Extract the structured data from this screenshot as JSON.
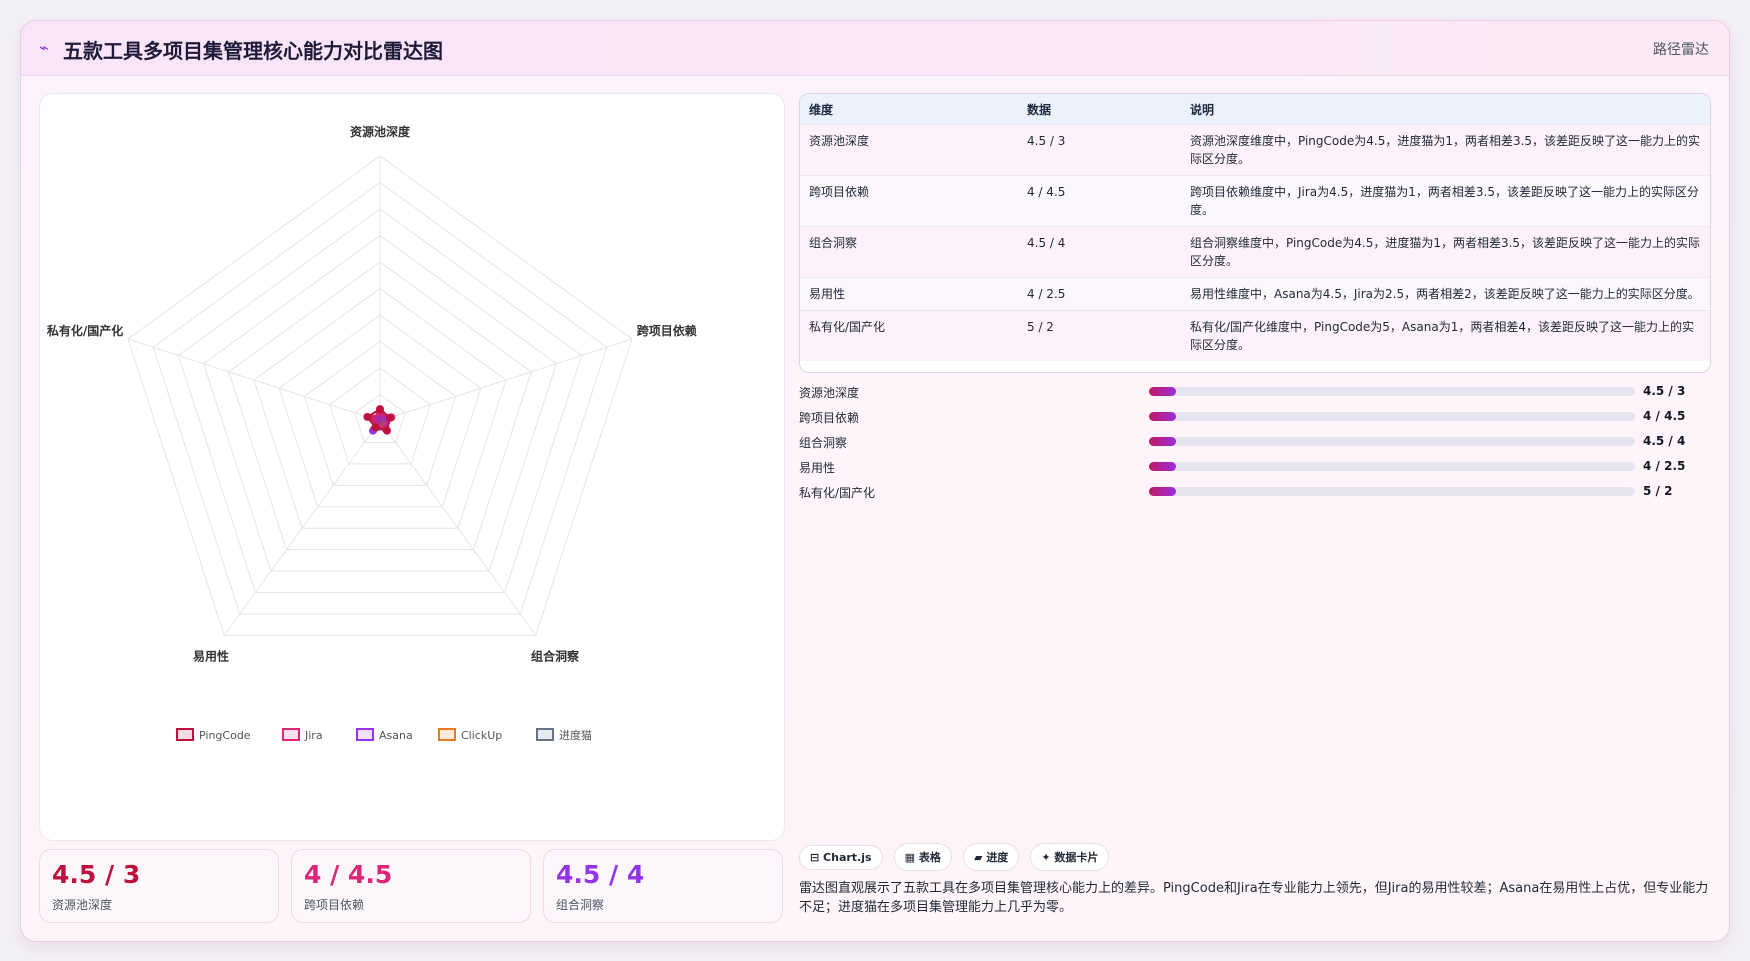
{
  "header": {
    "icon": "wave-icon",
    "title": "五款工具多项目集管理核心能力对比雷达图",
    "tag": "路径雷达"
  },
  "chart_data": {
    "type": "radar",
    "categories": [
      "资源池深度",
      "跨项目依赖",
      "组合洞察",
      "易用性",
      "私有化/国产化"
    ],
    "r_max": 100,
    "grid_levels": 10,
    "legend_position": "bottom",
    "series": [
      {
        "name": "PingCode",
        "values": [
          4.5,
          4,
          4.5,
          3,
          5
        ],
        "color": "#be123c"
      },
      {
        "name": "Jira",
        "values": [
          3.5,
          4.5,
          4,
          2.5,
          3
        ],
        "color": "#db2777"
      },
      {
        "name": "Asana",
        "values": [
          2.5,
          3,
          3.5,
          4.5,
          1
        ],
        "color": "#9333ea"
      },
      {
        "name": "ClickUp",
        "values": [
          3,
          3,
          3,
          4,
          1.5
        ],
        "color": "#ea7a1e"
      },
      {
        "name": "进度猫",
        "values": [
          1,
          1,
          1,
          4,
          2
        ],
        "color": "#64748b"
      }
    ]
  },
  "table": {
    "headers": [
      "维度",
      "数据",
      "说明"
    ],
    "rows": [
      {
        "dim": "资源池深度",
        "data": "4.5 / 3",
        "desc": "资源池深度维度中，PingCode为4.5，进度猫为1，两者相差3.5，该差距反映了这一能力上的实际区分度。"
      },
      {
        "dim": "跨项目依赖",
        "data": "4 / 4.5",
        "desc": "跨项目依赖维度中，Jira为4.5，进度猫为1，两者相差3.5，该差距反映了这一能力上的实际区分度。"
      },
      {
        "dim": "组合洞察",
        "data": "4.5 / 4",
        "desc": "组合洞察维度中，PingCode为4.5，进度猫为1，两者相差3.5，该差距反映了这一能力上的实际区分度。"
      },
      {
        "dim": "易用性",
        "data": "4 / 2.5",
        "desc": "易用性维度中，Asana为4.5，Jira为2.5，两者相差2，该差距反映了这一能力上的实际区分度。"
      },
      {
        "dim": "私有化/国产化",
        "data": "5 / 2",
        "desc": "私有化/国产化维度中，PingCode为5，Asana为1，两者相差4，该差距反映了这一能力上的实际区分度。"
      }
    ]
  },
  "progress": [
    {
      "label": "资源池深度",
      "value": "4.5 / 3",
      "fill_fraction": 0.055
    },
    {
      "label": "跨项目依赖",
      "value": "4 / 4.5",
      "fill_fraction": 0.055
    },
    {
      "label": "组合洞察",
      "value": "4.5 / 4",
      "fill_fraction": 0.055
    },
    {
      "label": "易用性",
      "value": "4 / 2.5",
      "fill_fraction": 0.055
    },
    {
      "label": "私有化/国产化",
      "value": "5 / 2",
      "fill_fraction": 0.055
    }
  ],
  "kpis": [
    {
      "value": "4.5 / 3",
      "label": "资源池深度",
      "color": "#be123c"
    },
    {
      "value": "4 / 4.5",
      "label": "跨项目依赖",
      "color": "#db2777"
    },
    {
      "value": "4.5 / 4",
      "label": "组合洞察",
      "color": "#9333ea"
    }
  ],
  "chips": [
    "⊟ Chart.js",
    "▦ 表格",
    "▰ 进度",
    "✦ 数据卡片"
  ],
  "summary": "雷达图直观展示了五款工具在多项目集管理核心能力上的差异。PingCode和Jira在专业能力上领先，但Jira的易用性较差；Asana在易用性上占优，但专业能力不足；进度猫在多项目集管理能力上几乎为零。"
}
